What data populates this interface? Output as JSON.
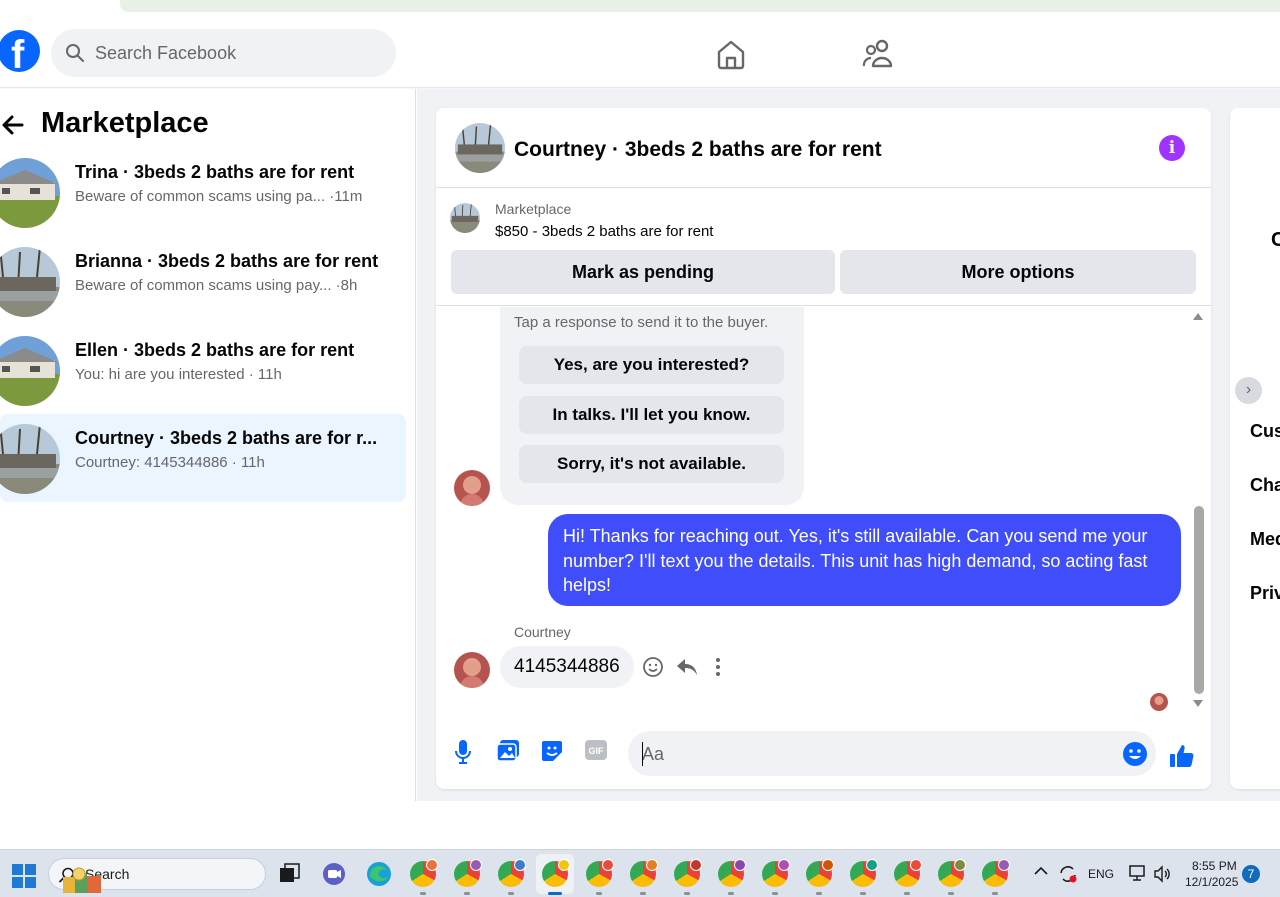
{
  "search": {
    "placeholder": "Search Facebook"
  },
  "sidebar": {
    "title": "Marketplace",
    "conversations": [
      {
        "name": "Trina · 3beds 2 baths are for rent",
        "preview": "Beware of common scams using pa... ·11m"
      },
      {
        "name": "Brianna · 3beds 2 baths are for rent",
        "preview": "Beware of common scams using pay... ·8h"
      },
      {
        "name": "Ellen · 3beds 2 baths are for rent",
        "preview": "You: hi are you interested · 11h"
      },
      {
        "name": "Courtney · 3beds 2 baths are for r...",
        "preview": "Courtney: 4145344886 · 11h"
      }
    ]
  },
  "chat": {
    "title": "Courtney · 3beds 2 baths are for rent",
    "listing": {
      "source": "Marketplace",
      "title": "$850 - 3beds 2 baths are for rent",
      "mark_pending": "Mark as pending",
      "more_options": "More options"
    },
    "quick_replies": {
      "hint": "Tap a response to send it to the buyer.",
      "options": [
        "Yes, are you interested?",
        "In talks. I'll let you know.",
        "Sorry, it's not available."
      ]
    },
    "outgoing_message": "Hi! Thanks for reaching out. Yes, it's still available. Can you send me your number? I'll text you the details. This unit has high demand, so acting fast helps!",
    "incoming_sender": "Courtney",
    "incoming_message": "4145344886",
    "composer_placeholder": "Aa"
  },
  "right_panel": {
    "letter": "C",
    "items": [
      "Cus",
      "Cha",
      "Med",
      "Priv"
    ]
  },
  "taskbar": {
    "search_label": "Search",
    "language": "ENG",
    "time": "8:55 PM",
    "date": "12/1/2025",
    "notifications": "7"
  },
  "colors": {
    "fb_blue": "#0866ff",
    "outgoing_bubble": "#3f4dfb",
    "info_purple": "#a033ff",
    "active_conversation": "#ebf5ff"
  }
}
